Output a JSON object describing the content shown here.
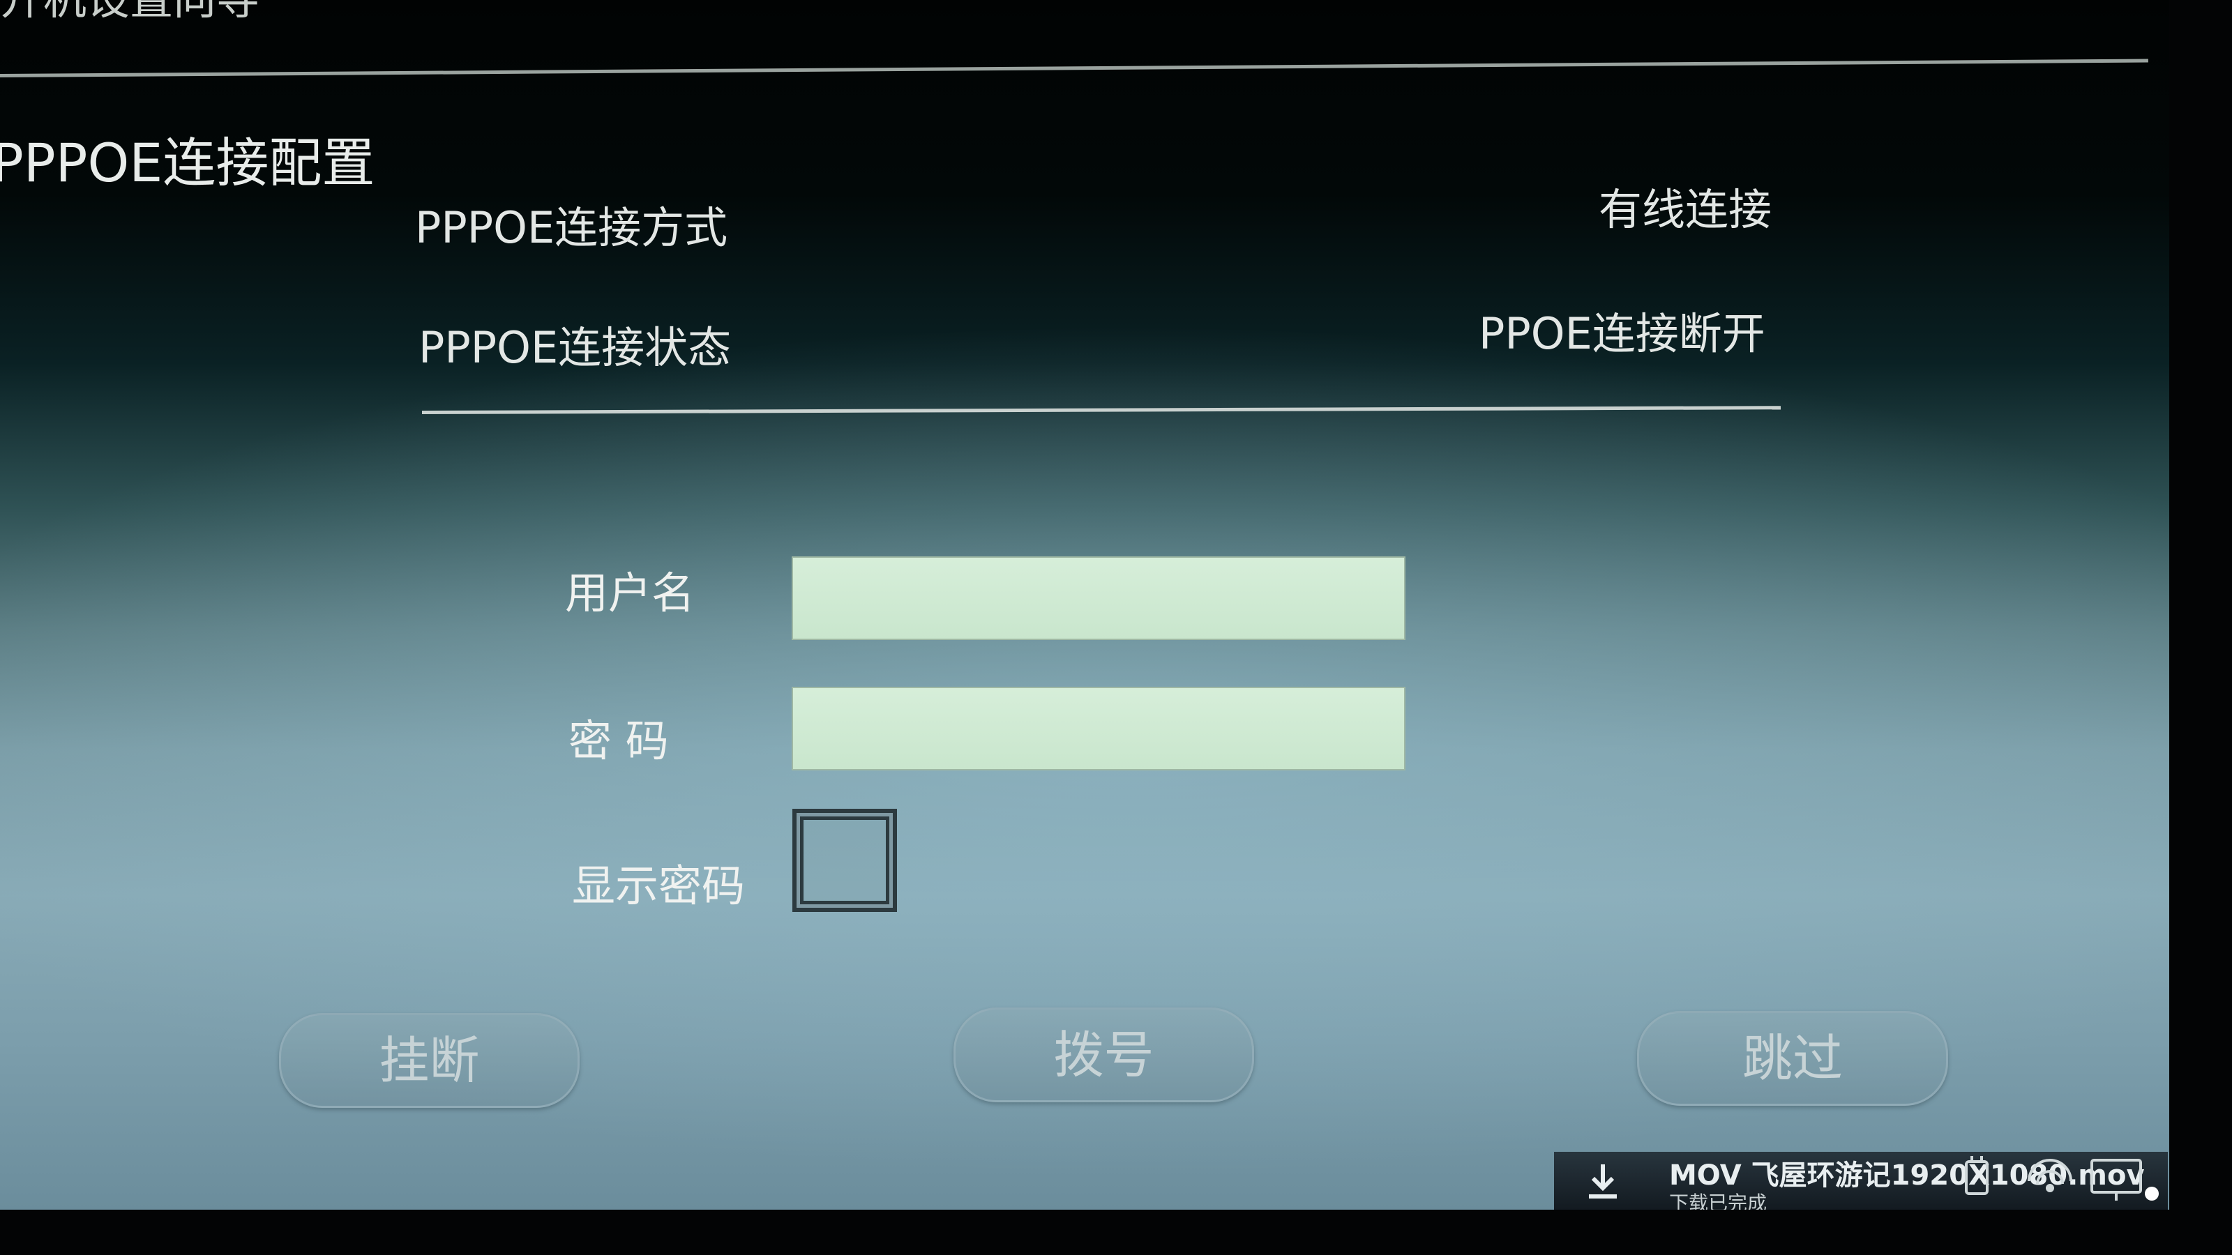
{
  "wizard": {
    "title": "开机设置向导"
  },
  "pppoe": {
    "section_heading": "PPPOE连接配置",
    "mode_label": "PPPOE连接方式",
    "mode_value": "有线连接",
    "status_label": "PPPOE连接状态",
    "status_value": "PPOE连接断开"
  },
  "form": {
    "username_label": "用户名",
    "username_value": "",
    "password_label": "密 码",
    "password_value": "",
    "show_password_label": "显示密码",
    "show_password_checked": false
  },
  "buttons": {
    "hangup": "挂断",
    "dial": "拨号",
    "skip": "跳过"
  },
  "notification": {
    "title": "MOV 飞屋环游记1920X1080.mov",
    "subtitle": "下载已完成",
    "icon": "download-icon"
  },
  "colors": {
    "input_bg": "#d6eed9",
    "text": "#e3e7e5"
  }
}
